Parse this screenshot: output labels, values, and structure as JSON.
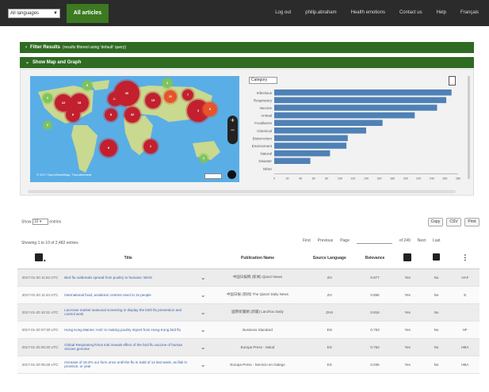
{
  "nav": {
    "language": "All languages",
    "all_articles": "All articles",
    "links": [
      "Log out",
      "philip.abraham",
      "Health emotions",
      "Contact us",
      "Help",
      "Français"
    ]
  },
  "filters": {
    "filter_results": "Filter Results",
    "filter_results_sub": "(results filtered using 'default' query)",
    "show_map": "Show Map and Graph"
  },
  "map": {
    "attribution": "© 2017 OpenStreetMap, Thunderforest",
    "clusters": [
      "3",
      "12",
      "8",
      "18",
      "5",
      "22",
      "40",
      "8",
      "32",
      "15",
      "4",
      "11",
      "7",
      "3",
      "6",
      "2",
      "1",
      "2",
      "9"
    ]
  },
  "chart_data": {
    "type": "bar",
    "orientation": "horizontal",
    "selector": "Category",
    "categories": [
      "Infectious",
      "Respiratory",
      "Vaccine",
      "Animal",
      "Foodborne",
      "Chemical",
      "Bioterrorism",
      "Environment",
      "Natural",
      "Disaster",
      "Other"
    ],
    "values": [
      270,
      262,
      248,
      214,
      165,
      140,
      112,
      110,
      85,
      55,
      0
    ],
    "xlim": [
      0,
      280
    ],
    "ticks": [
      "0",
      "20",
      "40",
      "60",
      "80",
      "100",
      "120",
      "140",
      "160",
      "180",
      "200",
      "220",
      "240",
      "260",
      "280"
    ],
    "bar_color": "#4f81b6"
  },
  "table_controls": {
    "show_label": "Show",
    "show_value": "10",
    "entries_label": "entries",
    "buttons": [
      "Copy",
      "CSV",
      "Print"
    ],
    "showing": "Showing 1 to 10 of 2,482 entries",
    "pager": [
      "First",
      "Previous",
      "Page",
      "of 249",
      "Next",
      "Last"
    ]
  },
  "table": {
    "headers": [
      "",
      "Title",
      "",
      "Publication Name",
      "Source Language",
      "Relevance",
      "",
      "",
      ""
    ],
    "rows": [
      {
        "date": "2017-01-20 11:52 UTC",
        "title": "Bird flu outbreaks spread from poultry to humans: WHO",
        "pub": "中国日报网 (新闻) Qianzi News",
        "lang": "ZH",
        "rel": "0.877",
        "a": "Yes",
        "b": "No",
        "c": "HAF"
      },
      {
        "date": "2017-01-20 11:44 UTC",
        "title": "International food, academic centres react to 2x people",
        "pub": "中国日报 (新闻) The Qianzi Daily News",
        "lang": "ZH",
        "rel": "0.855",
        "a": "Yes",
        "b": "No",
        "c": "E"
      },
      {
        "date": "2017-01-20 10:31 UTC",
        "title": "Lacrosse market seasonal screening in display the birth flu prevention and control work",
        "pub": "國際新聞網 (新聞) Lanzhou Daily",
        "lang": "ZHS",
        "rel": "0.816",
        "a": "Yes",
        "b": "No",
        "c": ""
      },
      {
        "date": "2017-01-20 07:30 UTC",
        "title": "Hong Kong Marine: H4C in making poultry import from Hong Kong bird flu",
        "pub": "Business Standard",
        "lang": "EN",
        "rel": "0.753",
        "a": "Yes",
        "b": "No",
        "c": "HF"
      },
      {
        "date": "2017-01-20 05:30 UTC",
        "title": "Global Respiratory/Virus trial reveals effect of the bird flu vaccine of human viruses genome",
        "pub": "Europa Press - Salud",
        "lang": "ES",
        "rel": "0.762",
        "a": "Yes",
        "b": "No",
        "c": "HBA"
      },
      {
        "date": "2017-01-20 05:28 UTC",
        "title": "Increase of 18.4% our form once until the flu in Sald of 14 last week, as flak in province, or year",
        "pub": "Europa Press - Servicio en Galego",
        "lang": "ES",
        "rel": "0.036",
        "a": "Yes",
        "b": "No",
        "c": "HBA"
      }
    ]
  }
}
